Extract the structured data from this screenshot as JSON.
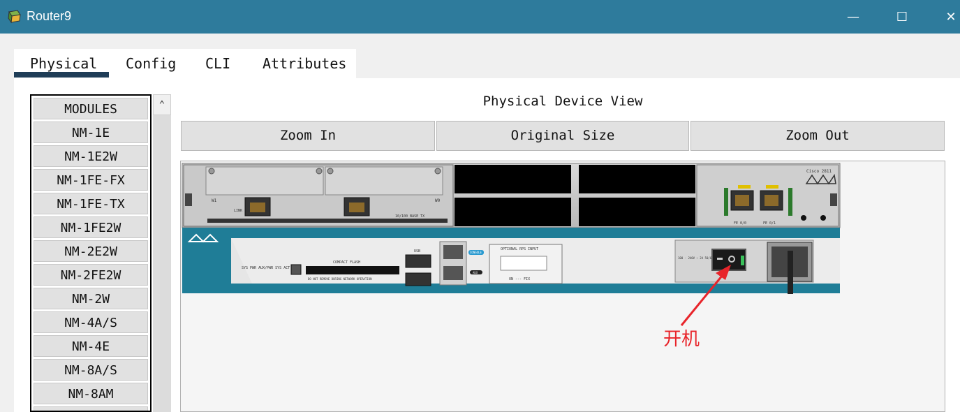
{
  "window": {
    "title": "Router9",
    "minimize": "—",
    "maximize": "☐",
    "close": "✕"
  },
  "tabs": [
    {
      "label": "Physical",
      "active": true
    },
    {
      "label": "Config"
    },
    {
      "label": "CLI"
    },
    {
      "label": "Attributes"
    }
  ],
  "modules": [
    "MODULES",
    "NM-1E",
    "NM-1E2W",
    "NM-1FE-FX",
    "NM-1FE-TX",
    "NM-1FE2W",
    "NM-2E2W",
    "NM-2FE2W",
    "NM-2W",
    "NM-4A/S",
    "NM-4E",
    "NM-8A/S",
    "NM-8AM"
  ],
  "scroll_up": "⌃",
  "device_view": {
    "title": "Physical Device View",
    "zoom_in": "Zoom In",
    "original_size": "Original Size",
    "zoom_out": "Zoom Out"
  },
  "device_labels": {
    "brand": "Cisco 2811",
    "compact_flash": "COMPACT FLASH",
    "cf_warning": "DO NOT REMOVE DURING NETWORK OPERATION",
    "rps": "OPTIONAL RPS INPUT",
    "usb": "USB",
    "console": "CONSOLE",
    "aux": "AUX",
    "base_tx": "10/100 BASE TX",
    "power_rating": "100 - 240V ~ 2A 50/60 Hz",
    "fe0": "FE 0/0",
    "fe1": "FE 0/1",
    "leds": "SYS PWR  AUX/PWR  SYS ACT  CF",
    "slot_s0": "S0",
    "slot_w0": "W0",
    "slot_w1": "W1",
    "link": "LINK",
    "rps_pins": "ON  ---  FIX"
  },
  "annotation": "开机",
  "colors": {
    "titlebar": "#2e7b9c",
    "annotation": "#e8242a",
    "tab_underline": "#1f3d57",
    "chassis_teal": "#1f7d97",
    "power_led": "#39c05a"
  }
}
